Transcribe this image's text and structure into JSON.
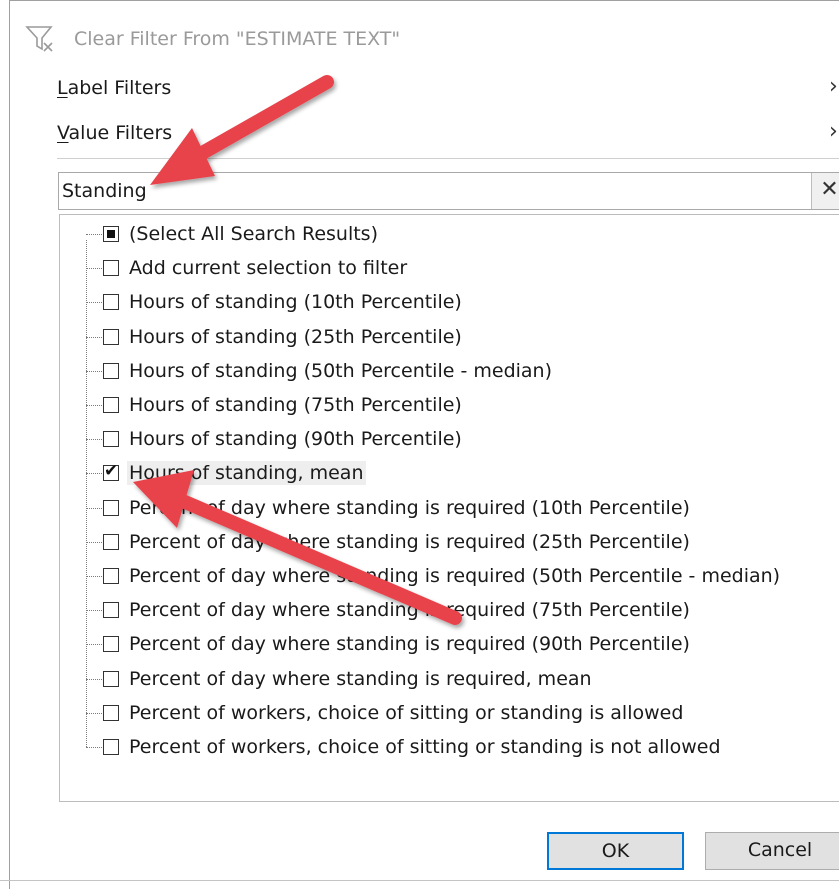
{
  "menu": {
    "clear_filter": "Clear Filter From \"ESTIMATE TEXT\"",
    "label_filters_accel": "L",
    "label_filters_rest": "abel Filters",
    "value_filters_accel": "V",
    "value_filters_rest": "alue Filters",
    "chevron": "›"
  },
  "search": {
    "value": "Standing",
    "clear_glyph": "✕"
  },
  "list": {
    "items": [
      {
        "label": "(Select All Search Results)",
        "state": "partial"
      },
      {
        "label": "Add current selection to filter",
        "state": "unchecked"
      },
      {
        "label": "Hours of standing (10th Percentile)",
        "state": "unchecked"
      },
      {
        "label": "Hours of standing (25th Percentile)",
        "state": "unchecked"
      },
      {
        "label": "Hours of standing (50th Percentile - median)",
        "state": "unchecked"
      },
      {
        "label": "Hours of standing (75th Percentile)",
        "state": "unchecked"
      },
      {
        "label": "Hours of standing (90th Percentile)",
        "state": "unchecked"
      },
      {
        "label": "Hours of standing, mean",
        "state": "checked"
      },
      {
        "label": "Percent of day where standing is required (10th Percentile)",
        "state": "unchecked"
      },
      {
        "label": "Percent of day where standing is required (25th Percentile)",
        "state": "unchecked"
      },
      {
        "label": "Percent of day where standing is required (50th Percentile - median)",
        "state": "unchecked"
      },
      {
        "label": "Percent of day where standing is required (75th Percentile)",
        "state": "unchecked"
      },
      {
        "label": "Percent of day where standing is required (90th Percentile)",
        "state": "unchecked"
      },
      {
        "label": "Percent of day where standing is required, mean",
        "state": "unchecked"
      },
      {
        "label": "Percent of workers, choice of sitting or standing is allowed",
        "state": "unchecked"
      },
      {
        "label": "Percent of workers, choice of sitting or standing is not allowed",
        "state": "unchecked"
      }
    ],
    "check_glyph": "✔"
  },
  "buttons": {
    "ok": "OK",
    "cancel": "Cancel"
  },
  "colors": {
    "annotation_arrow": "#e8434b",
    "ok_border": "#0078d7"
  }
}
